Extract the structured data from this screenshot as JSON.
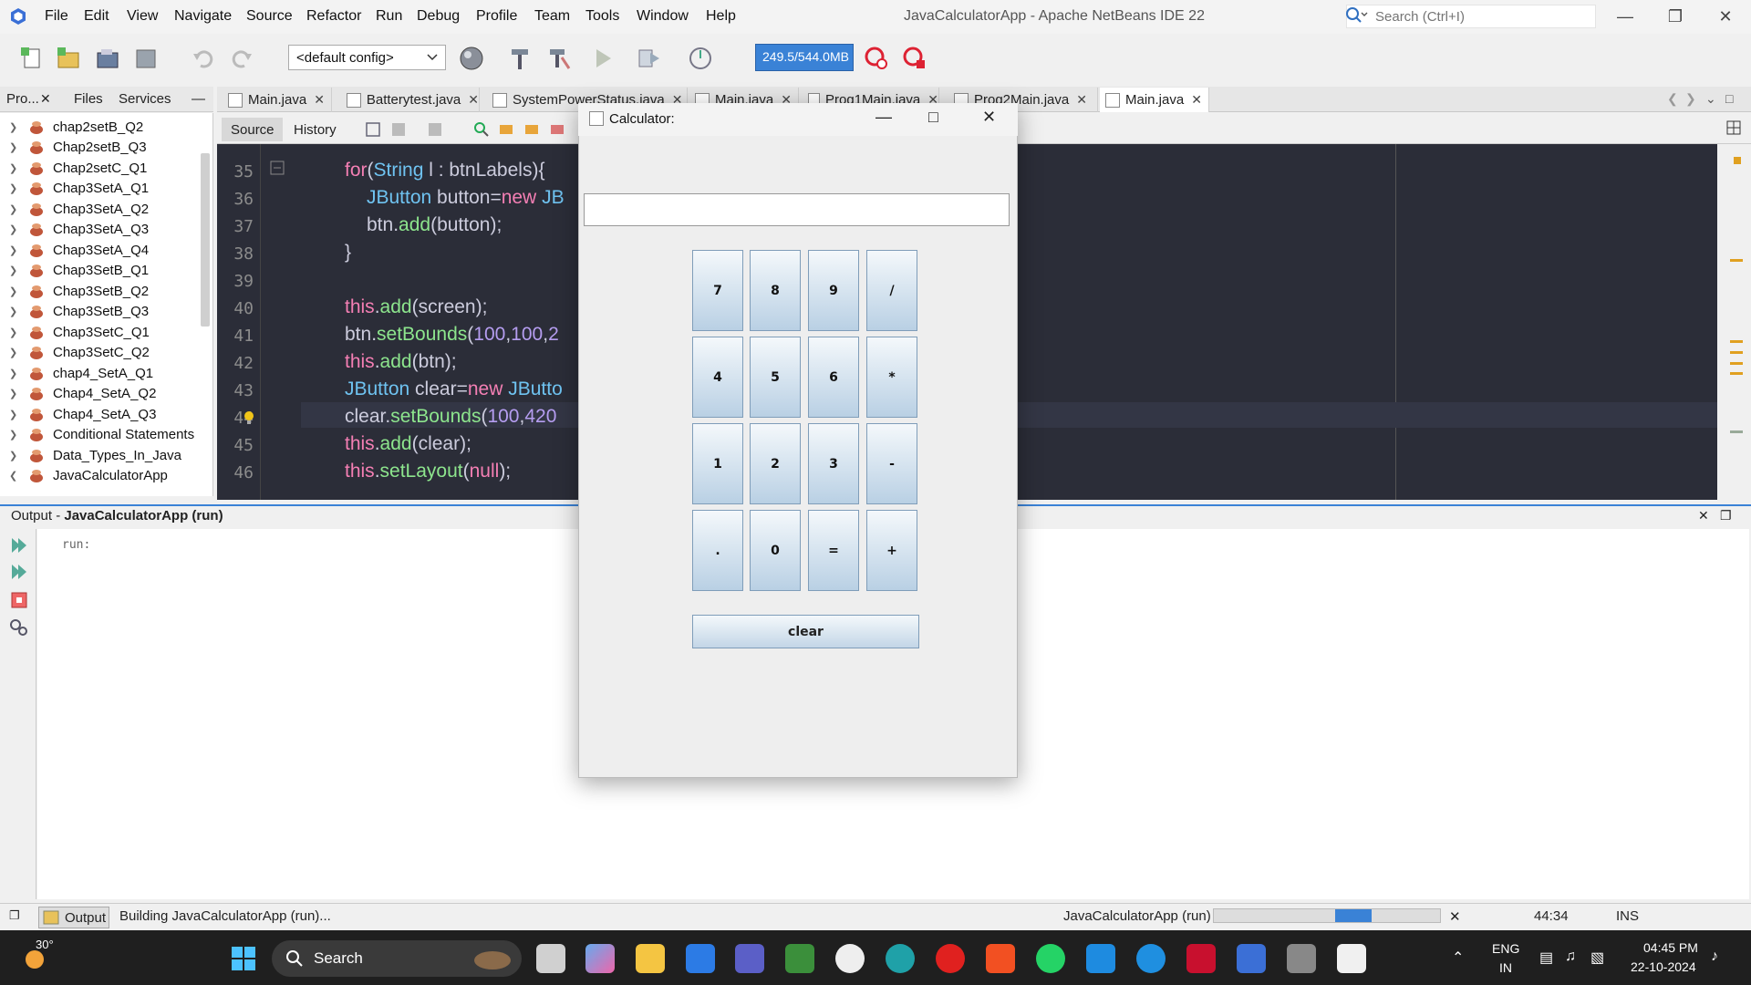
{
  "menu": {
    "items": [
      "File",
      "Edit",
      "View",
      "Navigate",
      "Source",
      "Refactor",
      "Run",
      "Debug",
      "Profile",
      "Team",
      "Tools",
      "Window",
      "Help"
    ],
    "window_title": "JavaCalculatorApp - Apache NetBeans IDE 22",
    "search_placeholder": "Search (Ctrl+I)"
  },
  "toolbar": {
    "config": "<default config>",
    "memory": "249.5/544.0MB"
  },
  "projects": {
    "tabs": [
      "Pro...",
      "Files",
      "Services"
    ],
    "items": [
      "chap2setB_Q2",
      "Chap2setB_Q3",
      "Chap2setC_Q1",
      "Chap3SetA_Q1",
      "Chap3SetA_Q2",
      "Chap3SetA_Q3",
      "Chap3SetA_Q4",
      "Chap3SetB_Q1",
      "Chap3SetB_Q2",
      "Chap3SetB_Q3",
      "Chap3SetC_Q1",
      "Chap3SetC_Q2",
      "chap4_SetA_Q1",
      "Chap4_SetA_Q2",
      "Chap4_SetA_Q3",
      "Conditional Statements",
      "Data_Types_In_Java",
      "JavaCalculatorApp"
    ]
  },
  "editor": {
    "tabs": [
      "Main.java",
      "Batterytest.java",
      "SystemPowerStatus.java",
      "Main.java",
      "Prog1Main.java",
      "Prog2Main.java",
      "Main.java"
    ],
    "source_label": "Source",
    "history_label": "History",
    "line_numbers": [
      "35",
      "36",
      "37",
      "38",
      "39",
      "40",
      "41",
      "42",
      "43",
      "44",
      "45",
      "46"
    ]
  },
  "output": {
    "title_prefix": "Output - ",
    "title_name": "JavaCalculatorApp (run)",
    "run_text": "run:"
  },
  "status": {
    "output_tab": "Output",
    "building": "Building JavaCalculatorApp (run)...",
    "run_label": "JavaCalculatorApp (run)",
    "position": "44:34",
    "mode": "INS"
  },
  "calculator": {
    "title": "Calculator:",
    "screen_value": "",
    "buttons": [
      "7",
      "8",
      "9",
      "/",
      "4",
      "5",
      "6",
      "*",
      "1",
      "2",
      "3",
      "-",
      ".",
      "0",
      "=",
      "+"
    ],
    "clear_label": "clear"
  },
  "taskbar": {
    "temperature": "30°",
    "search_label": "Search",
    "lang1": "ENG",
    "lang2": "IN",
    "time": "04:45 PM",
    "date": "22-10-2024"
  }
}
